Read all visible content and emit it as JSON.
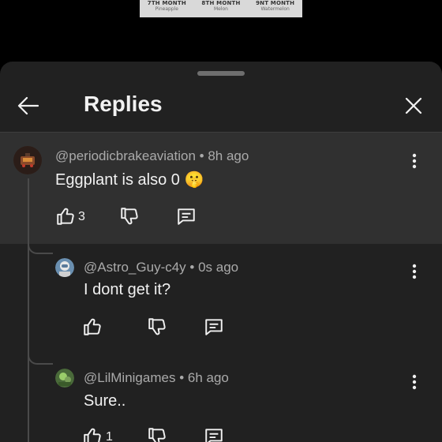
{
  "background": {
    "months": [
      {
        "month": "7TH MONTH",
        "fruit": "Pineapple"
      },
      {
        "month": "8TH MONTH",
        "fruit": "Melon"
      },
      {
        "month": "9NT MONTH",
        "fruit": "Watermelon"
      }
    ]
  },
  "header": {
    "title": "Replies",
    "back_icon": "arrow-left-icon",
    "close_icon": "close-icon"
  },
  "comments": [
    {
      "author": "@periodicbrakeaviation",
      "time": "8h ago",
      "text": "Eggplant is also 0 🤫",
      "likes": "3"
    },
    {
      "author": "@Astro_Guy-c4y",
      "time": "0s ago",
      "text": "I dont get it?",
      "likes": ""
    },
    {
      "author": "@LilMinigames",
      "time": "6h ago",
      "text": "Sure..",
      "likes": "1"
    }
  ],
  "separator": " • ",
  "colors": {
    "sheet": "#212121",
    "highlight": "#303030",
    "text": "#f1f1f1",
    "meta": "#aaaaaa"
  }
}
